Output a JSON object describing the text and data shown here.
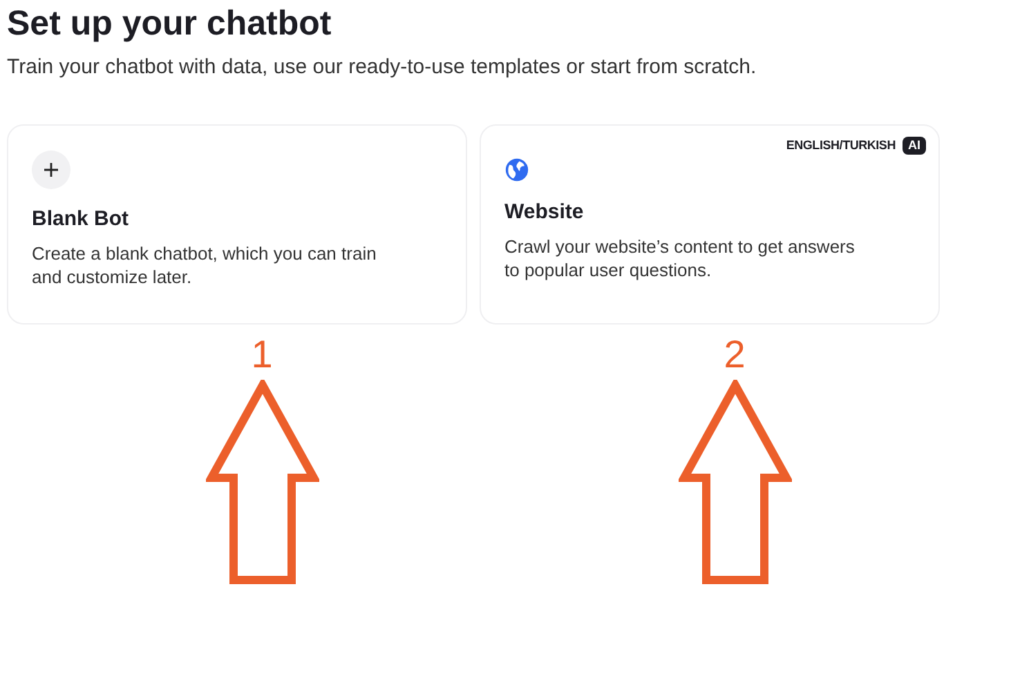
{
  "title": "Set up your chatbot",
  "subtitle": "Train your chatbot with data, use our ready-to-use templates or start from scratch.",
  "cards": [
    {
      "kind": "blank",
      "title": "Blank Bot",
      "description": "Create a blank chatbot, which you can train and customize later."
    },
    {
      "kind": "website",
      "title": "Website",
      "description": "Crawl your website’s content to get answers to popular user questions.",
      "badge": "ENGLISH/TURKISH",
      "tag": "AI"
    }
  ],
  "annotations": [
    {
      "label": "1"
    },
    {
      "label": "2"
    }
  ]
}
